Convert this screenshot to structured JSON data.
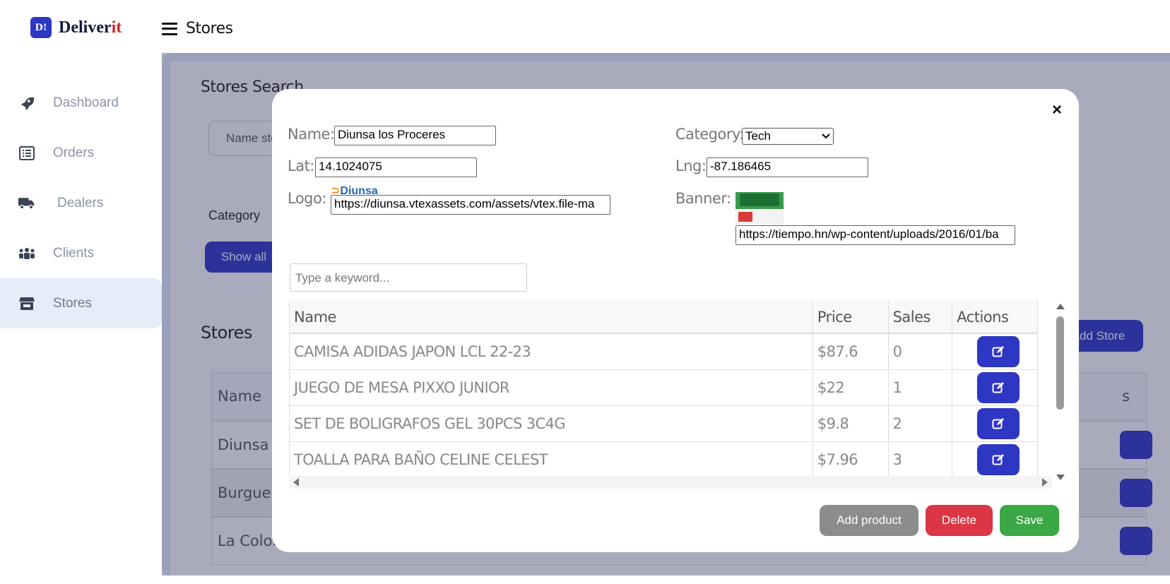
{
  "brand": {
    "badge": "D!",
    "name_main": "Deliver",
    "name_accent": "it"
  },
  "topbar": {
    "title": "Stores"
  },
  "sidebar": {
    "items": [
      {
        "label": "Dashboard",
        "icon": "rocket-icon"
      },
      {
        "label": "Orders",
        "icon": "list-icon"
      },
      {
        "label": "Dealers",
        "icon": "truck-icon"
      },
      {
        "label": "Clients",
        "icon": "users-icon"
      },
      {
        "label": "Stores",
        "icon": "store-icon",
        "active": true
      }
    ]
  },
  "background": {
    "search_title": "Stores Search",
    "search_placeholder": "Name sto",
    "category_label": "Category",
    "show_all_label": "Show all",
    "stores_title": "Stores",
    "add_store_label": "Add Store",
    "table_header_name": "Name",
    "table_header_actions": "s",
    "rows": [
      "Diunsa lo",
      "Burguer K",
      "La Coloni"
    ]
  },
  "modal": {
    "close_label": "×",
    "name_label": "Name:",
    "name_value": "Diunsa los Proceres",
    "category_label": "Category:",
    "category_value": "Tech",
    "lat_label": "Lat:",
    "lat_value": "14.1024075",
    "lng_label": "Lng:",
    "lng_value": "-87.186465",
    "logo_label": "Logo:",
    "logo_value": "https://diunsa.vtexassets.com/assets/vtex.file-ma",
    "logo_text": "Diunsa",
    "banner_label": "Banner:",
    "banner_value": "https://tiempo.hn/wp-content/uploads/2016/01/ba",
    "search_placeholder": "Type a keyword...",
    "table": {
      "headers": [
        "Name",
        "Price",
        "Sales",
        "Actions"
      ],
      "rows": [
        {
          "name": "CAMISA ADIDAS JAPON LCL 22-23",
          "price": "$87.6",
          "sales": "0"
        },
        {
          "name": "JUEGO DE MESA PIXXO JUNIOR",
          "price": "$22",
          "sales": "1"
        },
        {
          "name": "SET DE BOLIGRAFOS GEL 30PCS 3C4G",
          "price": "$9.8",
          "sales": "2"
        },
        {
          "name": "TOALLA PARA BAÑO CELINE CELEST",
          "price": "$7.96",
          "sales": "3"
        }
      ]
    },
    "buttons": {
      "add_product": "Add product",
      "delete": "Delete",
      "save": "Save"
    },
    "colors": {
      "primary": "#2e36c4",
      "danger": "#dc3545",
      "success": "#3aa845",
      "secondary": "#8c8c8c"
    }
  }
}
